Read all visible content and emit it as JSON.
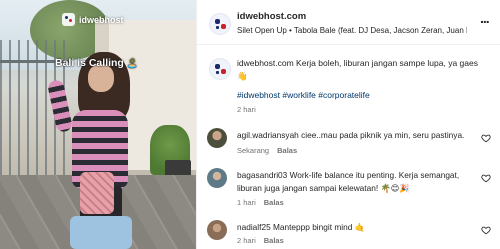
{
  "video": {
    "watermark": "idwebhost",
    "overlay_text": "Bali is Calling",
    "overlay_emoji": "🏝️"
  },
  "header": {
    "username": "idwebhost.com",
    "audio_line": "Silet Open Up • Tabola Bale (feat. DJ Desa, Jacson Zeran, Juan Reza &",
    "more_label": "..."
  },
  "post_caption": {
    "text": "idwebhost.com Kerja boleh, liburan jangan sampe lupa, ya gaes 👋",
    "tags": "#idwebhost #worklife #corporatelife",
    "time": "2 hari"
  },
  "comments": [
    {
      "text": "agil.wadriansyah ciee..mau pada piknik ya min, seru pastinya.",
      "time": "Sekarang",
      "reply": "Balas"
    },
    {
      "text": "bagasandri03 Work-life balance itu penting. Kerja semangat, liburan juga jangan sampai kelewatan! 🌴😊🎉",
      "time": "1 hari",
      "reply": "Balas"
    },
    {
      "text": "nadialf25 Manteppp bingit mind 🤙",
      "time": "2 hari",
      "reply": "Balas"
    }
  ],
  "colors": {
    "hashtag": "#00376b",
    "muted": "#737373",
    "brand_navy": "#1b2b6a",
    "brand_red": "#c8202d"
  },
  "icons": [
    "more-options-icon",
    "heart-icon"
  ]
}
